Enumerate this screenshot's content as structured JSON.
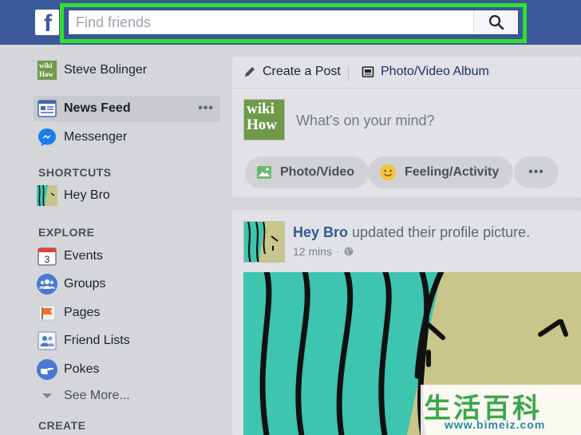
{
  "header": {
    "logo_letter": "f",
    "search": {
      "placeholder": "Find friends",
      "value": ""
    },
    "brand_color": "#3b5998",
    "highlight_color": "#31e02f"
  },
  "sidebar": {
    "profile": {
      "name": "Steve Bolinger",
      "avatar_text": "wiki How"
    },
    "items": [
      {
        "label": "News Feed",
        "icon": "news-feed-icon",
        "active": true,
        "more": "•••"
      },
      {
        "label": "Messenger",
        "icon": "messenger-icon"
      }
    ],
    "shortcuts": {
      "title": "SHORTCUTS",
      "items": [
        {
          "label": "Hey Bro",
          "icon": "group-avatar-icon"
        }
      ]
    },
    "explore": {
      "title": "EXPLORE",
      "items": [
        {
          "label": "Events",
          "icon": "calendar-icon",
          "icon_text": "3"
        },
        {
          "label": "Groups",
          "icon": "groups-icon"
        },
        {
          "label": "Pages",
          "icon": "flag-icon"
        },
        {
          "label": "Friend Lists",
          "icon": "friend-list-icon"
        },
        {
          "label": "Pokes",
          "icon": "poke-icon"
        },
        {
          "label": "See More...",
          "icon": "chevron-down-icon"
        }
      ]
    },
    "create": {
      "title": "CREATE"
    }
  },
  "composer": {
    "tabs": [
      {
        "label": "Create a Post",
        "icon": "pencil-icon"
      },
      {
        "label": "Photo/Video Album",
        "icon": "album-icon"
      }
    ],
    "avatar_text": "wiki How",
    "placeholder": "What's on your mind?",
    "actions": [
      {
        "label": "Photo/Video",
        "icon": "photo-icon"
      },
      {
        "label": "Feeling/Activity",
        "icon": "smiley-icon"
      },
      {
        "label": "•••",
        "icon": "more-icon"
      }
    ]
  },
  "post": {
    "author": "Hey Bro",
    "action": "updated their profile picture.",
    "time": "12 mins",
    "separator": "·",
    "privacy_icon": "globe-icon"
  },
  "watermark": {
    "chars": "生活百科",
    "url": "www.bimeiz.com"
  }
}
